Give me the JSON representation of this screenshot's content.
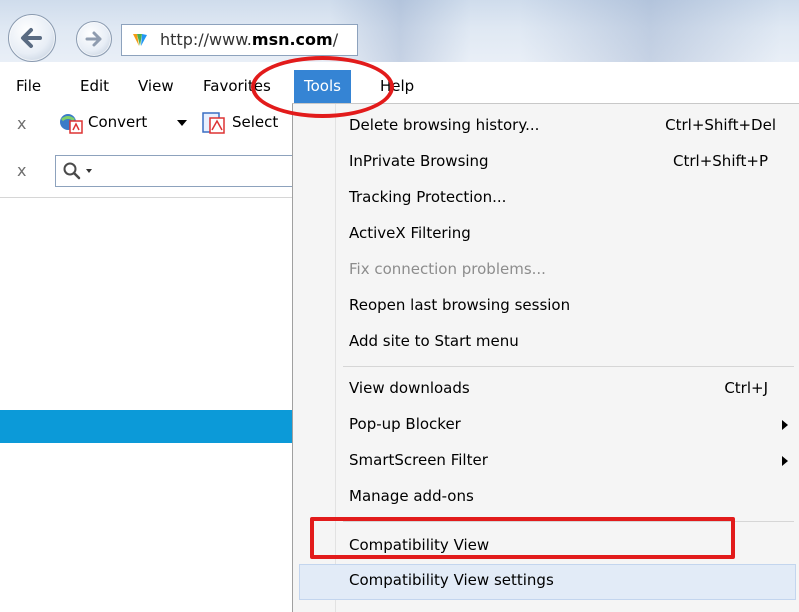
{
  "address_bar": {
    "url_prefix": "http://www.",
    "url_domain": "msn.com",
    "url_suffix": "/"
  },
  "menu_bar": {
    "items": [
      {
        "label": "File"
      },
      {
        "label": "Edit"
      },
      {
        "label": "View"
      },
      {
        "label": "Favorites"
      },
      {
        "label": "Tools"
      },
      {
        "label": "Help"
      }
    ],
    "active_item": "Tools"
  },
  "toolbar": {
    "close_glyph": "x",
    "convert_label": "Convert",
    "select_label": "Select"
  },
  "search_toolbar": {
    "close_glyph": "x"
  },
  "tools_menu": {
    "items": [
      {
        "label": "Delete browsing history...",
        "shortcut": "Ctrl+Shift+Del"
      },
      {
        "label": "InPrivate Browsing",
        "shortcut": "Ctrl+Shift+P"
      },
      {
        "label": "Tracking Protection..."
      },
      {
        "label": "ActiveX Filtering"
      },
      {
        "label": "Fix connection problems...",
        "disabled": true
      },
      {
        "label": "Reopen last browsing session"
      },
      {
        "label": "Add site to Start menu"
      },
      {
        "label": "View downloads",
        "shortcut": "Ctrl+J"
      },
      {
        "label": "Pop-up Blocker",
        "submenu": true
      },
      {
        "label": "SmartScreen Filter",
        "submenu": true
      },
      {
        "label": "Manage add-ons"
      },
      {
        "label": "Compatibility View"
      },
      {
        "label": "Compatibility View settings",
        "highlighted": true
      }
    ]
  },
  "colors": {
    "menu_active": "#3584d4",
    "annotation_red": "#e21b1b",
    "strip_blue": "#0c9ad8"
  }
}
